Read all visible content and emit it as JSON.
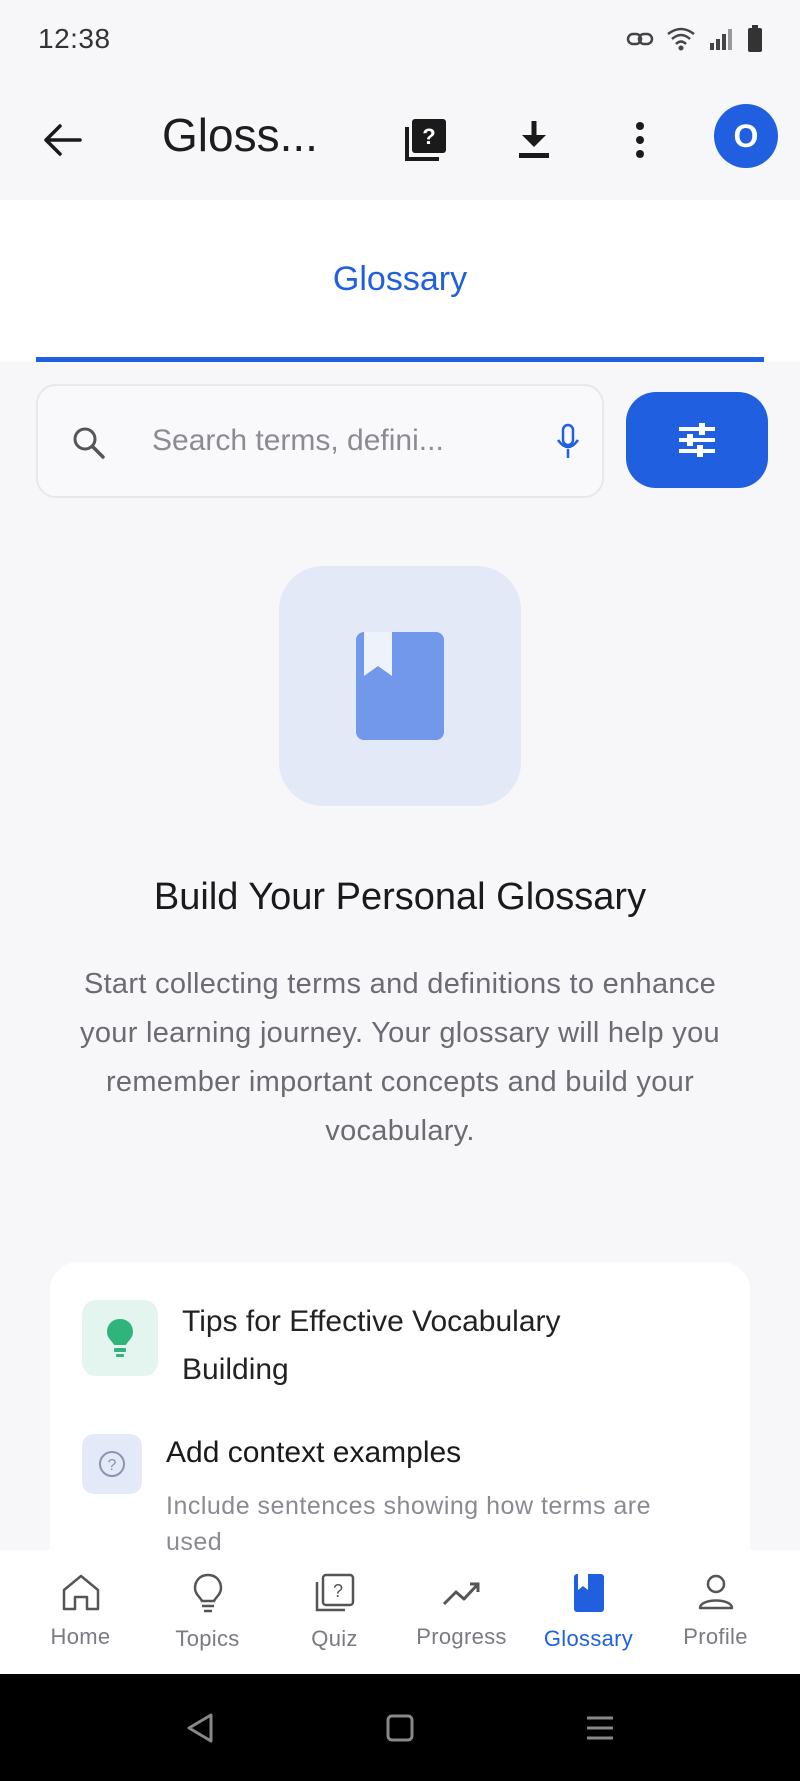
{
  "status_bar": {
    "time": "12:38",
    "icons": [
      "link-icon",
      "wifi-icon",
      "signal-icon",
      "battery-icon"
    ]
  },
  "app_bar": {
    "title": "Gloss...",
    "actions": [
      "quiz-icon",
      "download-icon",
      "more-vert-icon"
    ],
    "avatar_letter": "O"
  },
  "tabs": [
    {
      "label": "Glossary",
      "selected": true
    }
  ],
  "search": {
    "placeholder": "Search terms, defini..."
  },
  "empty_state": {
    "title": "Build Your Personal Glossary",
    "description": "Start collecting terms and definitions to enhance your learning journey. Your glossary will help you remember important concepts and build your vocabulary."
  },
  "tips": {
    "title": "Tips for Effective Vocabulary Building",
    "items": [
      {
        "title": "Add context examples",
        "description": "Include sentences showing how terms are used"
      }
    ]
  },
  "bottom_nav": {
    "items": [
      {
        "label": "Home",
        "icon": "home-icon"
      },
      {
        "label": "Topics",
        "icon": "lightbulb-icon"
      },
      {
        "label": "Quiz",
        "icon": "quiz-icon"
      },
      {
        "label": "Progress",
        "icon": "trending-icon"
      },
      {
        "label": "Glossary",
        "icon": "book-icon",
        "active": true
      },
      {
        "label": "Profile",
        "icon": "person-icon"
      }
    ]
  },
  "colors": {
    "accent": "#1f5fe0",
    "background": "#f7f7f9",
    "tip_green": "#2fb57c"
  }
}
